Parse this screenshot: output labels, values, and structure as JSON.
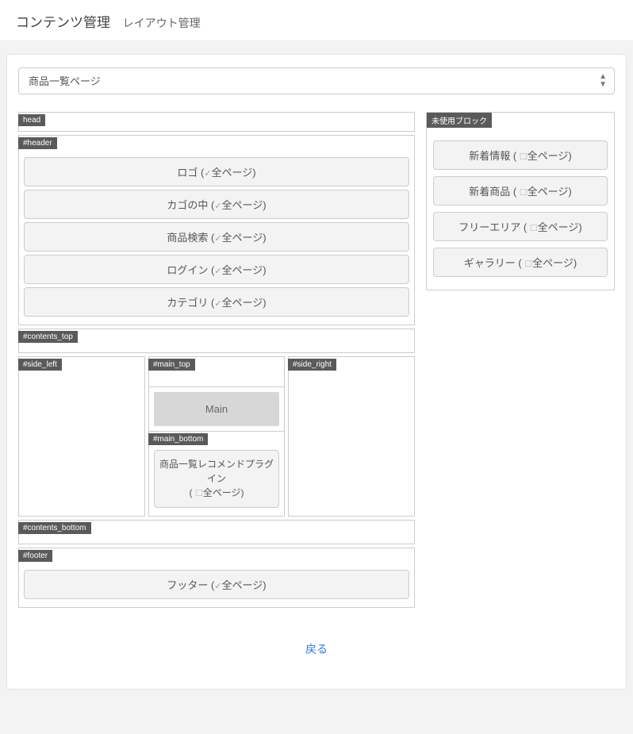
{
  "header": {
    "title": "コンテンツ管理",
    "subtitle": "レイアウト管理"
  },
  "page_select": {
    "selected": "商品一覧ページ"
  },
  "zones": {
    "head": {
      "label": "head"
    },
    "header": {
      "label": "#header",
      "blocks": [
        {
          "name": "ロゴ",
          "scope": "全ページ",
          "checked": true
        },
        {
          "name": "カゴの中",
          "scope": "全ページ",
          "checked": true
        },
        {
          "name": "商品検索",
          "scope": "全ページ",
          "checked": true
        },
        {
          "name": "ログイン",
          "scope": "全ページ",
          "checked": true
        },
        {
          "name": "カテゴリ",
          "scope": "全ページ",
          "checked": true
        }
      ]
    },
    "contents_top": {
      "label": "#contents_top"
    },
    "side_left": {
      "label": "#side_left"
    },
    "main_top": {
      "label": "#main_top"
    },
    "main": {
      "label": "Main"
    },
    "main_bottom": {
      "label": "#main_bottom",
      "blocks": [
        {
          "name": "商品一覧レコメンドプラグイン",
          "scope": "全ページ",
          "checked": false
        }
      ]
    },
    "side_right": {
      "label": "#side_right"
    },
    "contents_bottom": {
      "label": "#contents_bottom"
    },
    "footer": {
      "label": "#footer",
      "blocks": [
        {
          "name": "フッター",
          "scope": "全ページ",
          "checked": true
        }
      ]
    }
  },
  "unused": {
    "label": "未使用ブロック",
    "blocks": [
      {
        "name": "新着情報",
        "scope": "全ページ",
        "checked": false
      },
      {
        "name": "新着商品",
        "scope": "全ページ",
        "checked": false
      },
      {
        "name": "フリーエリア",
        "scope": "全ページ",
        "checked": false
      },
      {
        "name": "ギャラリー",
        "scope": "全ページ",
        "checked": false
      }
    ]
  },
  "footer": {
    "back": "戻る"
  }
}
